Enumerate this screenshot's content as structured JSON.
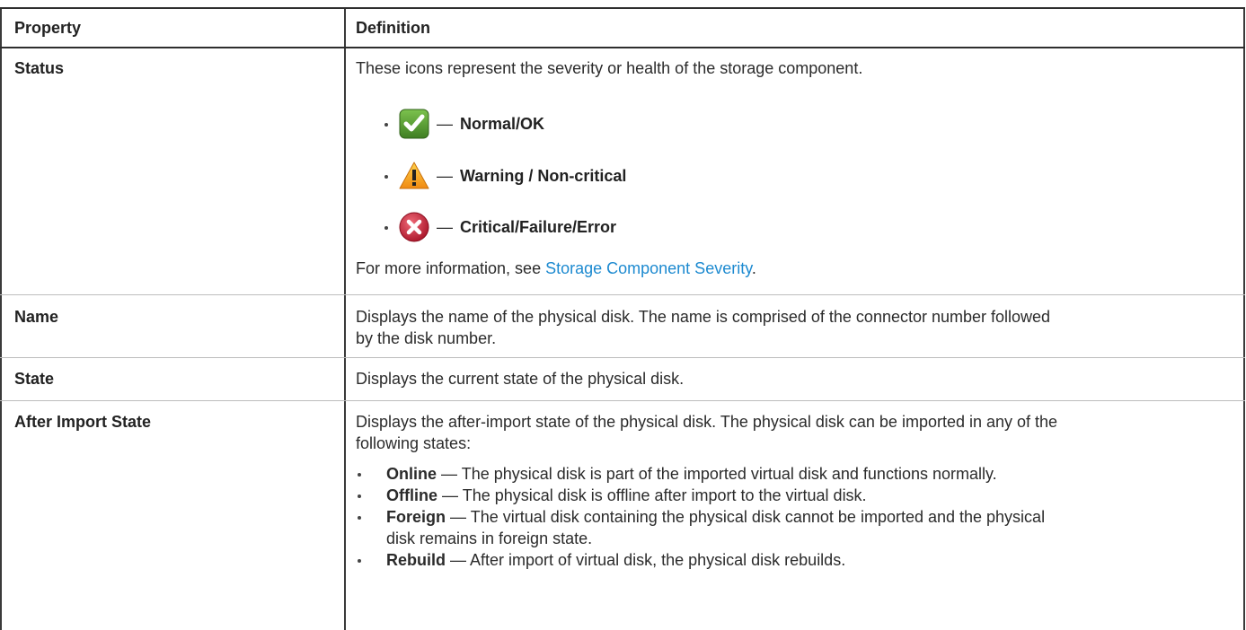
{
  "table": {
    "headers": {
      "property": "Property",
      "definition": "Definition"
    },
    "status": {
      "property": "Status",
      "intro": "These icons represent the severity or health of the storage component.",
      "items": [
        {
          "icon": "check-icon",
          "color": "#4f9a2e",
          "dash": "—",
          "label": "Normal/OK"
        },
        {
          "icon": "warning-icon",
          "color": "#f5a623",
          "dash": "—",
          "label": "Warning / Non-critical"
        },
        {
          "icon": "error-icon",
          "color": "#c9263a",
          "dash": "—",
          "label": "Critical/Failure/Error"
        }
      ],
      "more_prefix": "For more information, see ",
      "more_link": "Storage Component Severity",
      "more_suffix": "."
    },
    "name": {
      "property": "Name",
      "definition_line1": "Displays the name of the physical disk. The name is comprised of the connector number followed",
      "definition_line2": "by the disk number."
    },
    "state": {
      "property": "State",
      "definition": "Displays the current state of the physical disk."
    },
    "after_import": {
      "property": "After Import State",
      "definition_line1": "Displays the after-import state of the physical disk. The physical disk can be imported in any of the",
      "definition_line2": "following states:",
      "items": [
        {
          "term": "Online",
          "dash": "—",
          "text": "The physical disk is part of the imported virtual disk and functions normally."
        },
        {
          "term": "Offline",
          "dash": "—",
          "text": "The physical disk is offline after import to the virtual disk."
        },
        {
          "term": "Foreign",
          "dash": "—",
          "text": "The virtual disk containing the physical disk cannot be imported and the physical",
          "text2": "disk remains in foreign state."
        },
        {
          "term": "Rebuild",
          "dash": "—",
          "text": "After import of virtual disk, the physical disk rebuilds."
        }
      ]
    }
  }
}
